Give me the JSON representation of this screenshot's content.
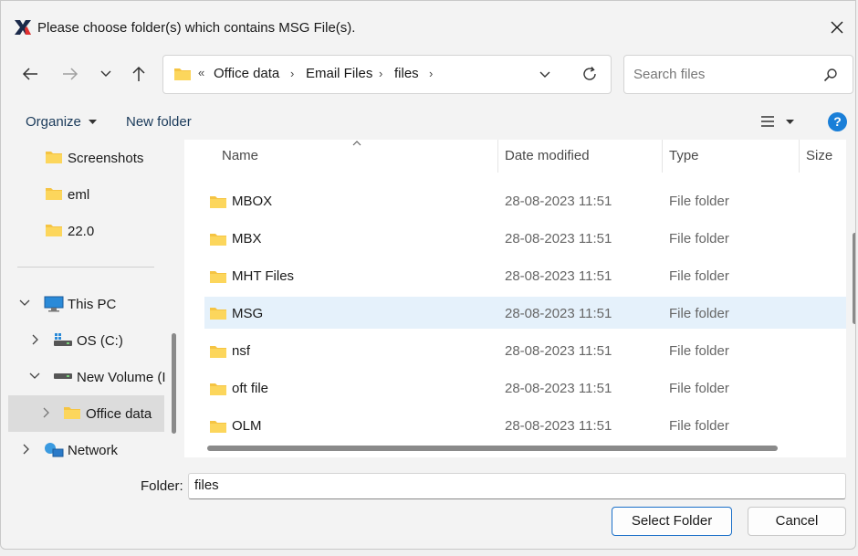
{
  "window": {
    "title": "Please choose folder(s) which contains MSG File(s).",
    "app_icon": "x-logo-icon"
  },
  "address_bar": {
    "overflow_glyph": "«",
    "breadcrumbs": [
      "Office data",
      "Email Files",
      "files"
    ],
    "separator": "›"
  },
  "search": {
    "placeholder": "Search files"
  },
  "toolbar": {
    "organize_label": "Organize",
    "new_folder_label": "New folder",
    "help_label": "?"
  },
  "nav_pane": {
    "items": [
      {
        "label": "Screenshots",
        "icon": "folder-icon"
      },
      {
        "label": "eml",
        "icon": "folder-icon"
      },
      {
        "label": "22.0",
        "icon": "folder-icon"
      },
      {
        "label": "This PC",
        "icon": "monitor-icon",
        "expanded": true
      },
      {
        "label": "OS (C:)",
        "icon": "drive-icon"
      },
      {
        "label": "New Volume (I",
        "icon": "drive-icon",
        "expanded": true
      },
      {
        "label": "Office data",
        "icon": "folder-icon",
        "selected": true
      },
      {
        "label": "Network",
        "icon": "network-icon"
      }
    ]
  },
  "file_list": {
    "columns": [
      "Name",
      "Date modified",
      "Type",
      "Size"
    ],
    "rows": [
      {
        "name": "MBOX",
        "date": "28-08-2023 11:51",
        "type": "File folder"
      },
      {
        "name": "MBX",
        "date": "28-08-2023 11:51",
        "type": "File folder"
      },
      {
        "name": "MHT Files",
        "date": "28-08-2023 11:51",
        "type": "File folder"
      },
      {
        "name": "MSG",
        "date": "28-08-2023 11:51",
        "type": "File folder",
        "selected": true
      },
      {
        "name": "nsf",
        "date": "28-08-2023 11:51",
        "type": "File folder"
      },
      {
        "name": "oft file",
        "date": "28-08-2023 11:51",
        "type": "File folder"
      },
      {
        "name": "OLM",
        "date": "28-08-2023 11:51",
        "type": "File folder"
      }
    ]
  },
  "footer": {
    "folder_label": "Folder:",
    "folder_value": "files",
    "select_button": "Select Folder",
    "cancel_button": "Cancel"
  },
  "colors": {
    "accent": "#1a7fd8",
    "selection": "#e5f1fb",
    "folder": "#f5c443"
  }
}
